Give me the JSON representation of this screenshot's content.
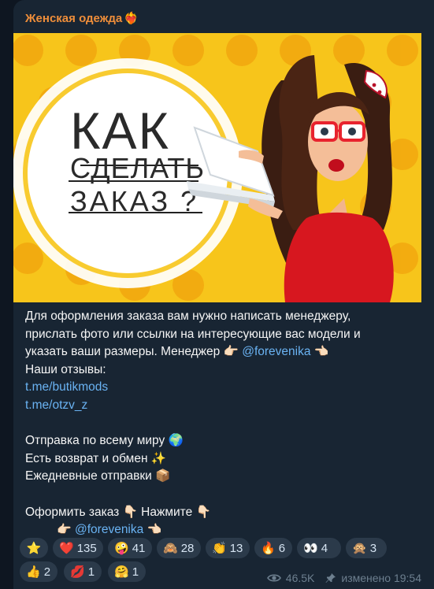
{
  "post": {
    "channel_name": "Женская одежда",
    "channel_heart": "❤‍🔥",
    "image": {
      "headline_1": "КАК",
      "headline_2": "СДЕЛАТЬ",
      "headline_3": "ЗАКАЗ ?"
    },
    "lines": {
      "l1": "Для оформления заказа вам нужно написать менеджеру,",
      "l2": "прислать фото или ссылки на интересующие вас модели и",
      "l3a": "указать ваши размеры. Менеджер 👉🏻",
      "l3b": "@forevenika",
      "l3c": "👈🏻",
      "l4": "Наши отзывы:",
      "l5": "t.me/butikmods",
      "l6": "t.me/otzv_z",
      "l7": "Отправка по всему миру 🌍",
      "l8": "Есть возврат и обмен ✨",
      "l9": "Ежедневные отправки 📦",
      "l10": "Оформить заказ 👇🏻 Нажмите 👇🏻",
      "l11a": "👉🏻",
      "l11b": "@forevenika",
      "l11c": "👈🏻"
    },
    "reactions": [
      {
        "emoji": "⭐",
        "count": ""
      },
      {
        "emoji": "❤️",
        "count": "135"
      },
      {
        "emoji": "🤪",
        "count": "41"
      },
      {
        "emoji": "🙈",
        "count": "28"
      },
      {
        "emoji": "👏",
        "count": "13"
      },
      {
        "emoji": "🔥",
        "count": "6"
      },
      {
        "emoji": "👀",
        "count": "4"
      },
      {
        "emoji": "🙊",
        "count": "3"
      },
      {
        "emoji": "👍",
        "count": "2"
      },
      {
        "emoji": "💋",
        "count": "1"
      },
      {
        "emoji": "🤗",
        "count": "1"
      }
    ],
    "views": "46.5K",
    "edited_label": "изменено 19:54"
  },
  "colors": {
    "background": "#0e1621",
    "bubble": "#182533",
    "channel_name": "#ef8e3a",
    "link": "#6ab3f3",
    "image_yellow": "#f7c51b",
    "dress_red": "#d7171f"
  },
  "icons": [
    "eye-icon",
    "pin-icon"
  ]
}
